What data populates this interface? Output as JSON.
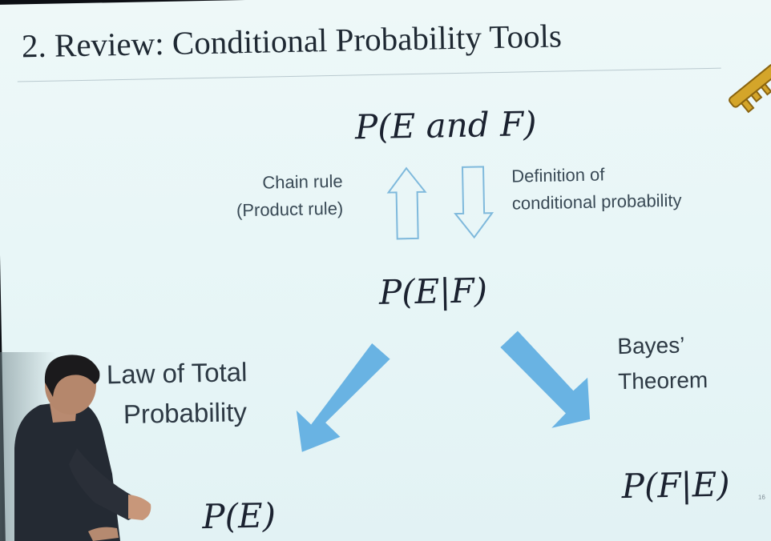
{
  "slide": {
    "title": "2. Review: Conditional Probability Tools",
    "top_formula": "P(E and F)",
    "middle_formula": "P(E|F)",
    "bottom_left_formula": "P(E)",
    "bottom_right_formula": "P(F|E)",
    "chain_rule_line1": "Chain rule",
    "chain_rule_line2": "(Product rule)",
    "definition_line1": "Definition of",
    "definition_line2": "conditional probability",
    "total_prob_line1": "Law of Total",
    "total_prob_line2": "Probability",
    "bayes_line1": "Bayes’",
    "bayes_line2": "Theorem",
    "slide_number": "16"
  },
  "colors": {
    "slide_background": "#e8f6f7",
    "title_text": "#1f2933",
    "arrow_fill": "#69b3e3",
    "outline_arrow": "#7fb9dc",
    "key_gold": "#d4a52a"
  },
  "icons": {
    "key": "key-icon"
  }
}
